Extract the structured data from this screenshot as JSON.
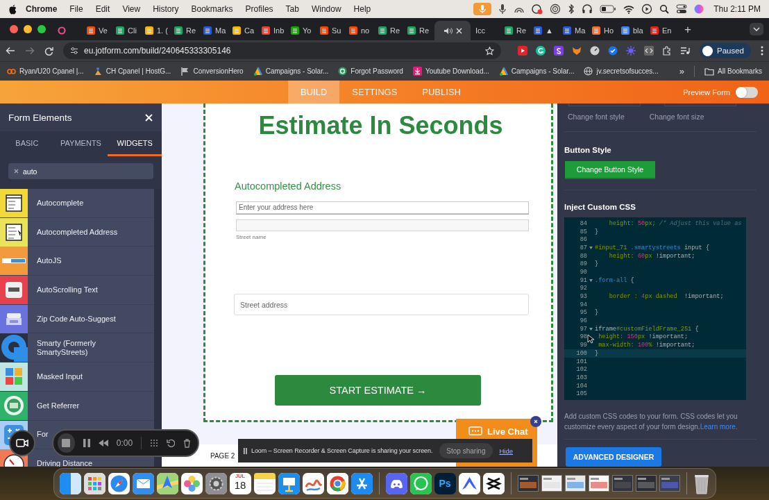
{
  "menu_bar": {
    "app": "Chrome",
    "menus": [
      "File",
      "Edit",
      "View",
      "History",
      "Bookmarks",
      "Profiles",
      "Tab",
      "Window",
      "Help"
    ],
    "clock": "Thu 2:11 PM"
  },
  "browser_tabs": [
    {
      "selected": false,
      "audio": false
    },
    {
      "title": "Ve",
      "selected": false,
      "audio": false
    },
    {
      "title": "Cli",
      "selected": false,
      "audio": false
    },
    {
      "title": "1. (",
      "selected": false,
      "audio": false
    },
    {
      "title": "Re",
      "selected": false,
      "audio": false
    },
    {
      "title": "Ma",
      "selected": false,
      "audio": false
    },
    {
      "title": "Ca",
      "selected": false,
      "audio": false
    },
    {
      "title": "Inb",
      "selected": false,
      "audio": false
    },
    {
      "title": "Yo",
      "selected": false,
      "audio": false
    },
    {
      "title": "Su",
      "selected": false,
      "audio": false
    },
    {
      "title": "no",
      "selected": false,
      "audio": false
    },
    {
      "title": "Re",
      "selected": false,
      "audio": false
    },
    {
      "title": "Re",
      "selected": false,
      "audio": false
    },
    {
      "selected": true,
      "audio": true
    },
    {
      "title": "Icc",
      "selected": false,
      "audio": false
    },
    {
      "title": "Re",
      "selected": false,
      "audio": false
    },
    {
      "title": "▲",
      "selected": false,
      "audio": false
    },
    {
      "title": "Ma",
      "selected": false,
      "audio": false
    },
    {
      "title": "Ho",
      "selected": false,
      "audio": false
    },
    {
      "title": "bla",
      "selected": false,
      "audio": false
    },
    {
      "title": "En",
      "selected": false,
      "audio": false
    }
  ],
  "new_tab": "+",
  "toolbar": {
    "url": "eu.jotform.com/build/240645333305146",
    "profile": "Paused"
  },
  "bookmarks": [
    "Ryan/U20 Cpanel |...",
    "CH Cpanel | HostG...",
    "ConversionHero",
    "Campaigns - Solar...",
    "Forgot Password",
    "Youtube Download...",
    "Campaigns - Solar...",
    "jv.secretsofsucces..."
  ],
  "bookmarks_more": "»",
  "all_bookmarks": "All Bookmarks",
  "builder_tabs": [
    {
      "label": "BUILD",
      "selected": true
    },
    {
      "label": "SETTINGS",
      "selected": false
    },
    {
      "label": "PUBLISH",
      "selected": false
    }
  ],
  "preview_form": {
    "label": "Preview Form",
    "on": false
  },
  "form_elements": {
    "title": "Form Elements",
    "tabs": [
      {
        "label": "BASIC",
        "selected": false
      },
      {
        "label": "PAYMENTS",
        "selected": false
      },
      {
        "label": "WIDGETS",
        "selected": true
      }
    ],
    "search": {
      "value": "auto"
    },
    "items": [
      {
        "label": "Autocomplete",
        "kind": "list"
      },
      {
        "label": "Autocompleted Address",
        "kind": "address"
      },
      {
        "label": "AutoJS",
        "kind": "script"
      },
      {
        "label": "AutoScrolling Text",
        "kind": "card"
      },
      {
        "label": "Zip Code Auto-Suggest",
        "kind": "zip"
      },
      {
        "label": "Smarty (Formerly SmartyStreets)",
        "kind": "ring"
      },
      {
        "label": "Masked Input",
        "kind": "tiles"
      },
      {
        "label": "Get Referrer",
        "kind": "globe"
      },
      {
        "label": "For",
        "kind": "calculator"
      },
      {
        "label": "Driving Distance",
        "kind": "gauge"
      }
    ]
  },
  "form": {
    "title": "Estimate In Seconds",
    "address_label": "Autocompleted Address",
    "address_placeholder": "Enter your address here",
    "street_name_label": "Street name",
    "street_address_placeholder": "Street address",
    "submit": "START ESTIMATE →"
  },
  "page_label": "PAGE 2",
  "design_panel": {
    "font_style": "Change font style",
    "font_size": "Change font size",
    "button_style_heading": "Button Style",
    "button_style_button": "Change Button Style",
    "css_heading": "Inject Custom CSS",
    "code_lines": [
      {
        "number": "84",
        "fold": false,
        "current": false,
        "tokens": [
          {
            "text": "    height: ",
            "kind": "property"
          },
          {
            "text": "50",
            "kind": "number"
          },
          {
            "text": "px; ",
            "kind": "property"
          },
          {
            "text": "/* Adjust this value as",
            "kind": "comment"
          }
        ]
      },
      {
        "number": "85",
        "fold": false,
        "current": false,
        "tokens": [
          {
            "text": "}",
            "kind": "plain"
          }
        ]
      },
      {
        "number": "86",
        "fold": false,
        "current": false
      },
      {
        "number": "87",
        "fold": true,
        "current": false,
        "tokens": [
          {
            "text": "#input_71",
            "kind": "id"
          },
          {
            "text": " .smartystreets",
            "kind": "class"
          },
          {
            "text": " input {",
            "kind": "plain"
          }
        ]
      },
      {
        "number": "88",
        "fold": false,
        "current": false,
        "tokens": [
          {
            "text": "    height: ",
            "kind": "property"
          },
          {
            "text": "60",
            "kind": "number"
          },
          {
            "text": "px",
            "kind": "property"
          },
          {
            "text": " !important;",
            "kind": "plain"
          }
        ]
      },
      {
        "number": "89",
        "fold": false,
        "current": false,
        "tokens": [
          {
            "text": "}",
            "kind": "plain"
          }
        ]
      },
      {
        "number": "90",
        "fold": false,
        "current": false
      },
      {
        "number": "91",
        "fold": true,
        "current": false,
        "tokens": [
          {
            "text": ".form-all",
            "kind": "class"
          },
          {
            "text": " {",
            "kind": "plain"
          }
        ]
      },
      {
        "number": "92",
        "fold": false,
        "current": false
      },
      {
        "number": "93",
        "fold": false,
        "current": false,
        "tokens": [
          {
            "text": "    border : ",
            "kind": "property"
          },
          {
            "text": "4",
            "kind": "number"
          },
          {
            "text": "px dashed  ",
            "kind": "property"
          },
          {
            "text": "!important;",
            "kind": "plain"
          }
        ]
      },
      {
        "number": "94",
        "fold": false,
        "current": false
      },
      {
        "number": "95",
        "fold": false,
        "current": false,
        "tokens": [
          {
            "text": "}",
            "kind": "plain"
          }
        ]
      },
      {
        "number": "96",
        "fold": false,
        "current": false
      },
      {
        "number": "97",
        "fold": true,
        "current": false,
        "tokens": [
          {
            "text": "iframe",
            "kind": "plain"
          },
          {
            "text": "#customFieldFrame_251",
            "kind": "id"
          },
          {
            "text": " {",
            "kind": "plain"
          }
        ]
      },
      {
        "number": "98",
        "fold": false,
        "current": false,
        "tokens": [
          {
            "text": " height: ",
            "kind": "property"
          },
          {
            "text": "150",
            "kind": "number"
          },
          {
            "text": "px",
            "kind": "property"
          },
          {
            "text": " !important;",
            "kind": "plain"
          }
        ]
      },
      {
        "number": "99",
        "fold": false,
        "current": false,
        "tokens": [
          {
            "text": " max-width: ",
            "kind": "property"
          },
          {
            "text": "100",
            "kind": "number"
          },
          {
            "text": "%",
            "kind": "property"
          },
          {
            "text": " !important;",
            "kind": "plain"
          }
        ]
      },
      {
        "number": "100",
        "fold": false,
        "current": true,
        "tokens": [
          {
            "text": "}",
            "kind": "plain"
          }
        ]
      },
      {
        "number": "101",
        "fold": false,
        "current": false
      },
      {
        "number": "102",
        "fold": false,
        "current": false
      },
      {
        "number": "103",
        "fold": false,
        "current": false
      },
      {
        "number": "104",
        "fold": false,
        "current": false
      },
      {
        "number": "105",
        "fold": false,
        "current": false
      }
    ],
    "help_text": "Add custom CSS codes to your form. CSS codes let you customize every aspect of your form design.",
    "help_link": "Learn more.",
    "advanced_button": "ADVANCED DESIGNER"
  },
  "loom_controls": {
    "timer": "0:00"
  },
  "loom_banner": {
    "message": "Loom – Screen Recorder & Screen Capture is sharing your screen.",
    "stop": "Stop sharing",
    "hide": "Hide"
  },
  "live_chat": {
    "label": "Live Chat"
  },
  "dock": {
    "calendar_month": "JUL",
    "calendar_day": "18",
    "photoshop": "Ps"
  }
}
